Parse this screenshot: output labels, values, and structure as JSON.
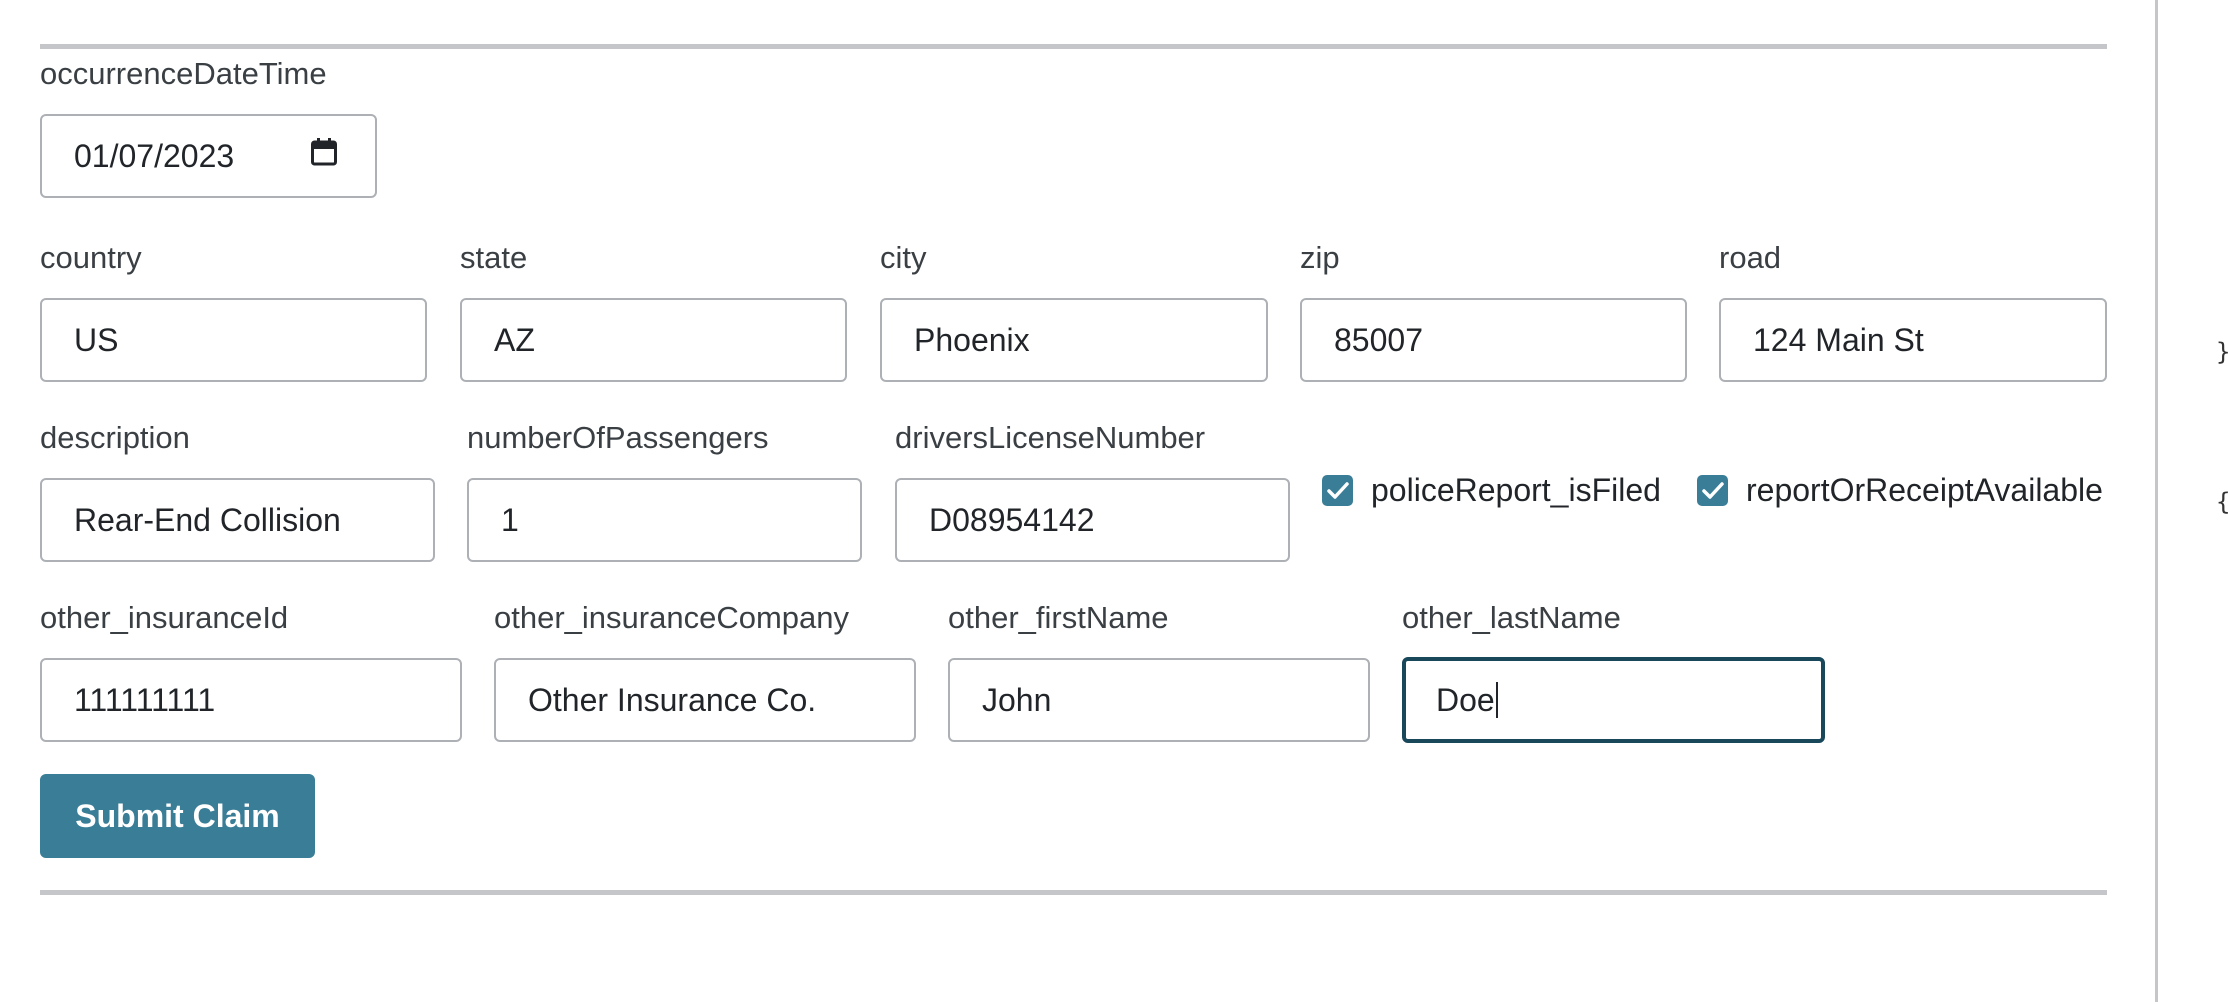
{
  "form": {
    "occurrence": {
      "label": "occurrenceDateTime",
      "value": "01/07/2023"
    },
    "row1": [
      {
        "label": "country",
        "value": "US"
      },
      {
        "label": "state",
        "value": "AZ"
      },
      {
        "label": "city",
        "value": "Phoenix"
      },
      {
        "label": "zip",
        "value": "85007"
      },
      {
        "label": "road",
        "value": "124 Main St"
      }
    ],
    "row2": [
      {
        "label": "description",
        "value": "Rear-End Collision"
      },
      {
        "label": "numberOfPassengers",
        "value": "1"
      },
      {
        "label": "driversLicenseNumber",
        "value": "D08954142"
      }
    ],
    "checkboxes": [
      {
        "label": "policeReport_isFiled",
        "checked": true
      },
      {
        "label": "reportOrReceiptAvailable",
        "checked": true
      }
    ],
    "row3": [
      {
        "label": "other_insuranceId",
        "value": "111111111"
      },
      {
        "label": "other_insuranceCompany",
        "value": "Other Insurance Co."
      },
      {
        "label": "other_firstName",
        "value": "John"
      },
      {
        "label": "other_lastName",
        "value": "Doe"
      }
    ],
    "submit_label": "Submit Claim"
  },
  "side_panel": {
    "glyph_top": "}",
    "glyph_bottom": "{"
  },
  "colors": {
    "accent": "#3a7d97",
    "focus_border": "#18485a",
    "divider": "#c4c6c9"
  }
}
